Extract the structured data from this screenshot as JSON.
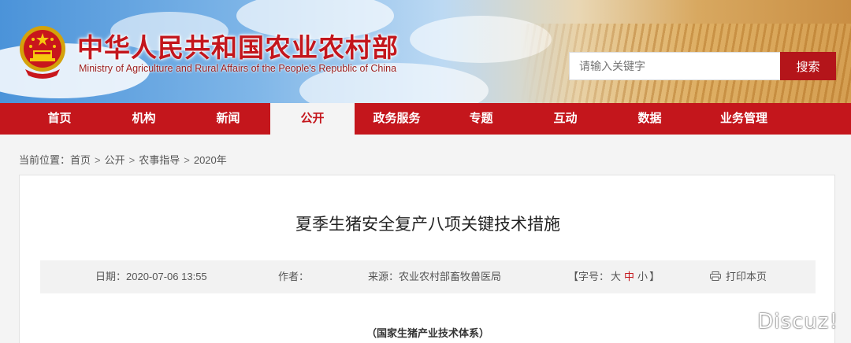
{
  "header": {
    "title_cn": "中华人民共和国农业农村部",
    "title_en": "Ministry of Agriculture and Rural Affairs of the People's Republic of China",
    "emblem_icon": "national-emblem-icon",
    "search": {
      "placeholder": "请输入关键字",
      "button_label": "搜索"
    },
    "colors": {
      "brand_red": "#c4161c",
      "search_btn": "#b4151a"
    }
  },
  "nav": {
    "items": [
      {
        "label": "首页"
      },
      {
        "label": "机构"
      },
      {
        "label": "新闻"
      },
      {
        "label": "公开",
        "active": true
      },
      {
        "label": "政务服务"
      },
      {
        "label": "专题"
      },
      {
        "label": "互动"
      },
      {
        "label": "数据"
      },
      {
        "label": "业务管理"
      }
    ]
  },
  "breadcrumb": {
    "prefix": "当前位置：",
    "items": [
      "首页",
      "公开",
      "农事指导",
      "2020年"
    ],
    "separator": ">"
  },
  "article": {
    "title": "夏季生猪安全复产八项关键技术措施",
    "meta": {
      "date_label": "日期：",
      "date": "2020-07-06 13:55",
      "author_label": "作者：",
      "source_label": "来源：",
      "source": "农业农村部畜牧兽医局",
      "font_size_open": "【字号：",
      "font_large": "大",
      "font_medium": "中",
      "font_small": "小",
      "font_size_close": "】",
      "print_icon": "printer-icon",
      "print_label": "打印本页"
    },
    "organization": "（国家生猪产业技术体系）"
  },
  "watermark": "Discuz!"
}
